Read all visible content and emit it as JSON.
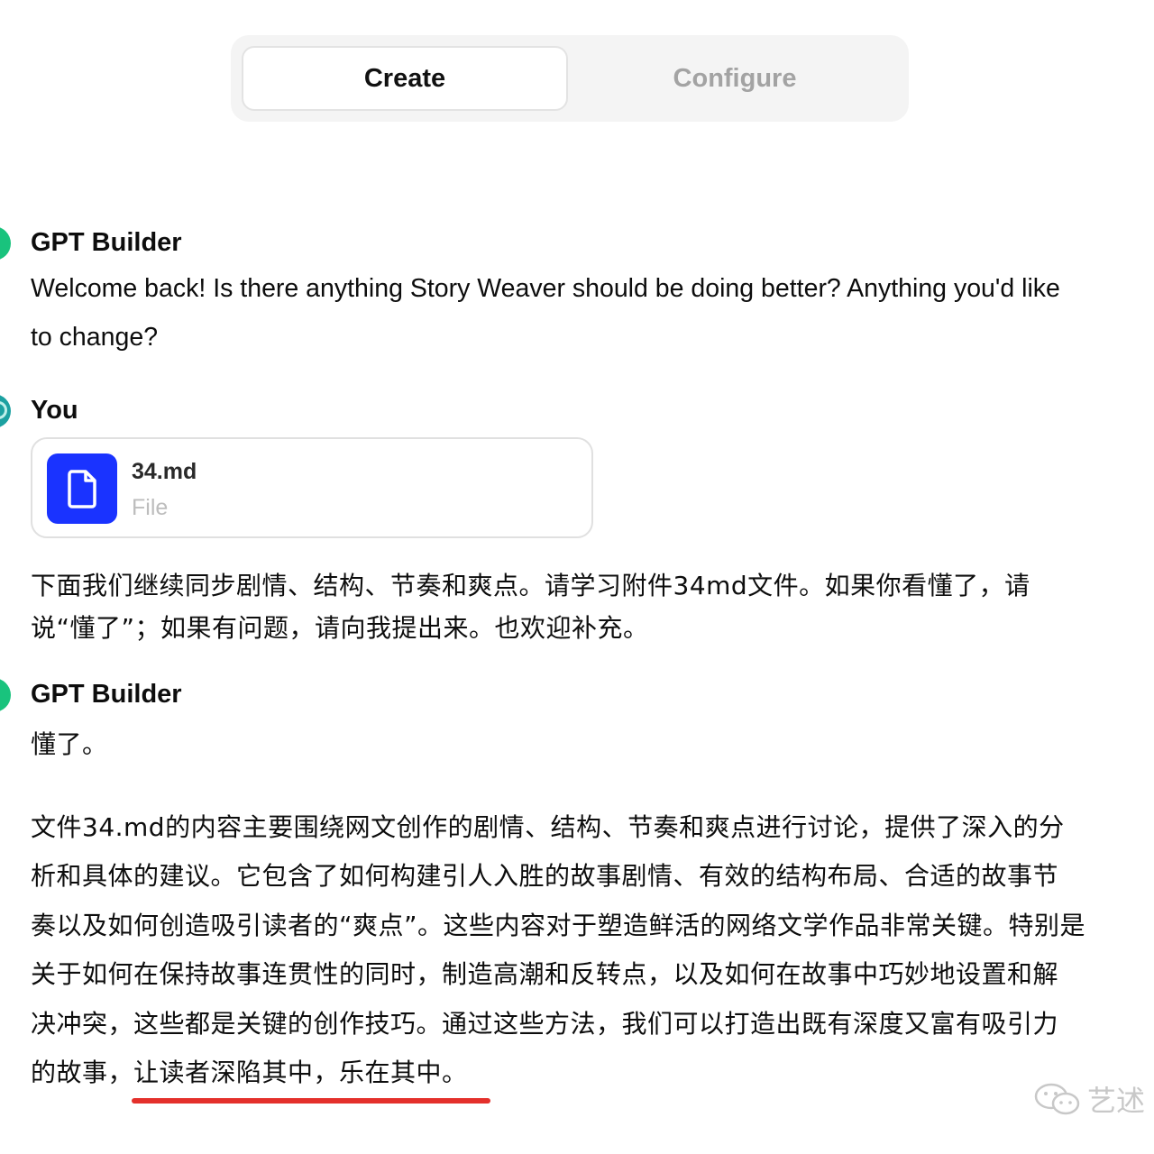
{
  "tabs": {
    "create_label": "Create",
    "configure_label": "Configure"
  },
  "conversation": {
    "message1": {
      "author": "GPT Builder",
      "lines": [
        "Welcome back! Is there anything Story Weaver should be doing better? Anything you'd like",
        "to change?"
      ]
    },
    "message2": {
      "author": "You",
      "attachment": {
        "name": "34.md",
        "type": "File",
        "icon": "file-icon"
      },
      "lines": [
        "下面我们继续同步剧情、结构、节奏和爽点。请学习附件34md文件。如果你看懂了，请",
        "说“懂了”；如果有问题，请向我提出来。也欢迎补充。"
      ]
    },
    "message3": {
      "author": "GPT Builder",
      "first_line": "懂了。",
      "lines": [
        "文件34.md的内容主要围绕网文创作的剧情、结构、节奏和爽点进行讨论，提供了深入的分",
        "析和具体的建议。它包含了如何构建引人入胜的故事剧情、有效的结构布局、合适的故事节",
        "奏以及如何创造吸引读者的“爽点”。这些内容对于塑造鲜活的网络文学作品非常关键。特别是",
        "关于如何在保持故事连贯性的同时，制造高潮和反转点，以及如何在故事中巧妙地设置和解",
        "决冲突，这些都是关键的创作技巧。通过这些方法，我们可以打造出既有深度又富有吸引力",
        "的故事，让读者深陷其中，乐在其中。"
      ]
    }
  },
  "watermark": {
    "text": "艺述",
    "icon": "wechat-icon"
  },
  "colors": {
    "gpt_avatar": "#19c37d",
    "user_avatar": "#1ca1a1",
    "file_icon_bg": "#1a33ff",
    "highlight_underline": "#e4302b"
  }
}
